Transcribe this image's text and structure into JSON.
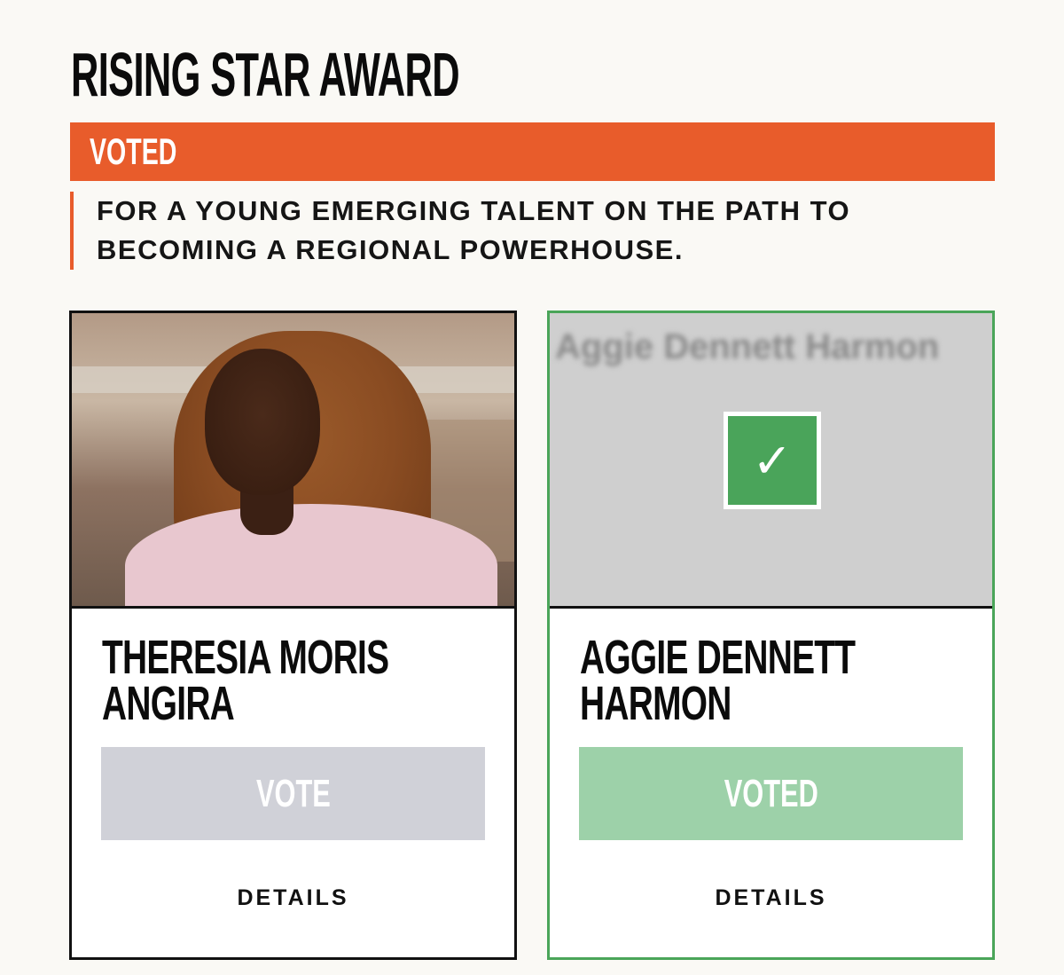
{
  "award": {
    "title": "RISING STAR AWARD",
    "status": "VOTED",
    "description": "FOR A YOUNG EMERGING TALENT ON THE PATH TO BECOMING A REGIONAL POWERHOUSE."
  },
  "colors": {
    "accent": "#e85c2b",
    "voted_green": "#4aa45a",
    "voted_button": "#9dd1a9",
    "vote_button": "#d0d1d8"
  },
  "nominees": [
    {
      "name": "THERESIA MORIS ANGIRA",
      "button_label": "VOTE",
      "details_label": "DETAILS",
      "selected": false
    },
    {
      "name": "AGGIE DENNETT HARMON",
      "placeholder_text": "Aggie Dennett Harmon",
      "button_label": "VOTED",
      "details_label": "DETAILS",
      "selected": true,
      "check_icon": "check-icon"
    }
  ]
}
